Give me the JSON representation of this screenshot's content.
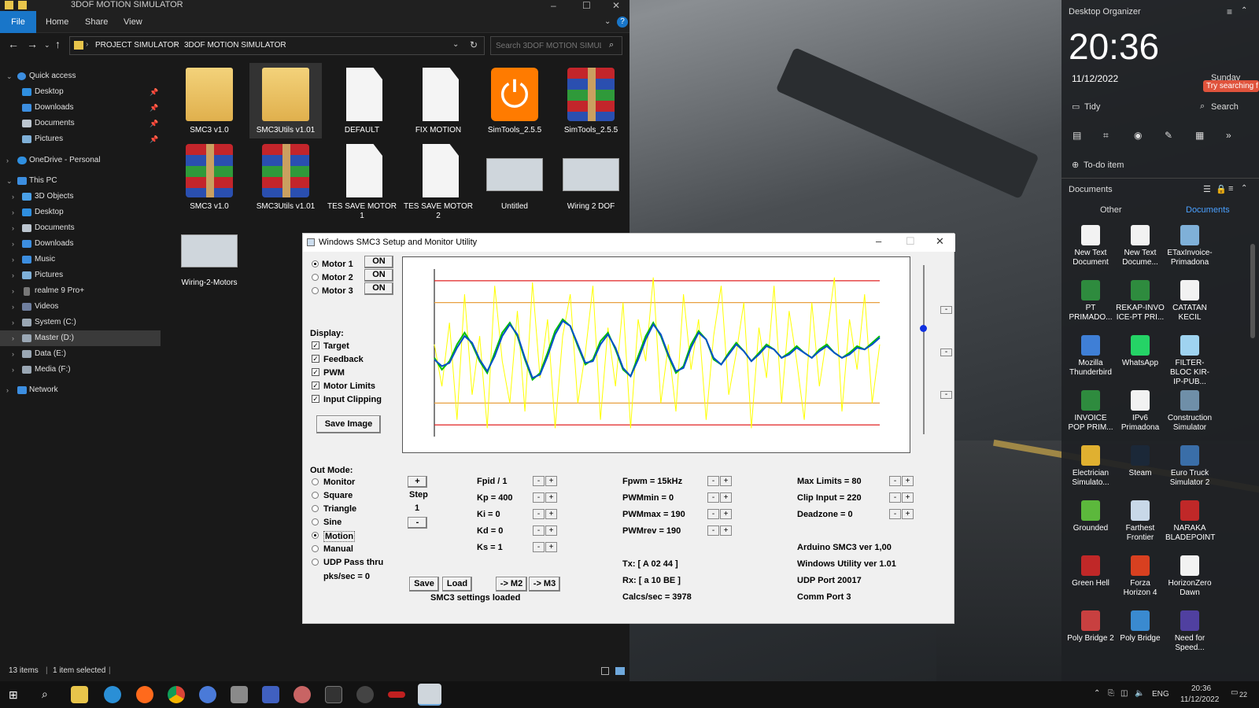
{
  "explorer": {
    "window_title": "3DOF MOTION SIMULATOR",
    "ribbon_tabs": [
      "File",
      "Home",
      "Share",
      "View"
    ],
    "breadcrumb": [
      "PROJECT SIMULATOR",
      "3DOF MOTION SIMULATOR"
    ],
    "search_placeholder": "Search 3DOF MOTION SIMUL...",
    "nav": {
      "quick_access": "Quick access",
      "quick_items": [
        "Desktop",
        "Downloads",
        "Documents",
        "Pictures"
      ],
      "onedrive": "OneDrive - Personal",
      "this_pc": "This PC",
      "pc_items": [
        "3D Objects",
        "Desktop",
        "Documents",
        "Downloads",
        "Music",
        "Pictures",
        "realme 9 Pro+",
        "Videos",
        "System (C:)",
        "Master (D:)",
        "Data (E:)",
        "Media (F:)"
      ],
      "network": "Network"
    },
    "files": [
      {
        "name": "SMC3 v1.0",
        "kind": "folder"
      },
      {
        "name": "SMC3Utils v1.01",
        "kind": "folder"
      },
      {
        "name": "DEFAULT",
        "kind": "doc"
      },
      {
        "name": "FIX MOTION",
        "kind": "doc"
      },
      {
        "name": "SimTools_2.5.5",
        "kind": "simtools"
      },
      {
        "name": "SimTools_2.5.5",
        "kind": "rar"
      },
      {
        "name": "SMC3 v1.0",
        "kind": "rar"
      },
      {
        "name": "SMC3Utils v1.01",
        "kind": "rar"
      },
      {
        "name": "TES SAVE MOTOR 1",
        "kind": "doc"
      },
      {
        "name": "TES SAVE MOTOR 2",
        "kind": "doc"
      },
      {
        "name": "Untitled",
        "kind": "thumb"
      },
      {
        "name": "Wiring 2 DOF",
        "kind": "thumb"
      },
      {
        "name": "Wiring-2-Motors",
        "kind": "thumb"
      }
    ],
    "status": {
      "items": "13 items",
      "selected": "1 item selected"
    }
  },
  "smc3": {
    "title": "Windows SMC3 Setup and Monitor Utility",
    "motors": [
      {
        "label": "Motor 1",
        "state": "ON",
        "selected": true
      },
      {
        "label": "Motor 2",
        "state": "ON",
        "selected": false
      },
      {
        "label": "Motor 3",
        "state": "ON",
        "selected": false
      }
    ],
    "display_label": "Display:",
    "display_items": [
      "Target",
      "Feedback",
      "PWM",
      "Motor Limits",
      "Input Clipping"
    ],
    "save_image": "Save Image",
    "out_mode_label": "Out Mode:",
    "out_modes": [
      "Monitor",
      "Square",
      "Triangle",
      "Sine",
      "Motion",
      "Manual",
      "UDP Pass thru"
    ],
    "out_mode_selected": "Motion",
    "pks": "pks/sec = 0",
    "step": {
      "plus": "+",
      "label": "Step",
      "value": "1",
      "minus": "-"
    },
    "params_col1": [
      "Fpid / 1",
      "Kp = 400",
      "Ki = 0",
      "Kd = 0",
      "Ks = 1"
    ],
    "params_col2": [
      "Fpwm = 15kHz",
      "PWMmin = 0",
      "PWMmax = 190",
      "PWMrev = 190"
    ],
    "params_col3": [
      "Max Limits = 80",
      "Clip Input = 220",
      "Deadzone = 0"
    ],
    "buttons": {
      "save": "Save",
      "load": "Load",
      "m2": "-> M2",
      "m3": "-> M3"
    },
    "settings_msg": "SMC3 settings loaded",
    "tx": "Tx: [ A 02 44 ]",
    "rx": "Rx: [ a 10 BE ]",
    "calcs": "Calcs/sec = 3978",
    "info": [
      "Arduino SMC3 ver 1,00",
      "Windows Utility ver 1.01",
      "UDP Port 20017",
      "Comm Port 3"
    ],
    "pm_minus": "-",
    "pm_plus": "+",
    "side_btn": "-"
  },
  "organizer": {
    "title": "Desktop Organizer",
    "time": "20:36",
    "date": "11/12/2022",
    "day": "Sunday",
    "tooltip": "Try searching f",
    "tidy": "Tidy",
    "search": "Search",
    "todo": "To-do item",
    "docs_title": "Documents",
    "tabs": [
      "Other",
      "Documents"
    ],
    "icons": [
      {
        "label": "New Text Document",
        "color": "#f2f2f2"
      },
      {
        "label": "New Text Docume...",
        "color": "#f2f2f2"
      },
      {
        "label": "ETaxInvoice-Primadona",
        "color": "#7fb0d8"
      },
      {
        "label": "PT PRIMADO...",
        "color": "#2e8b3e"
      },
      {
        "label": "REKAP-INVO ICE-PT PRI...",
        "color": "#2e8b3e"
      },
      {
        "label": "CATATAN KECIL",
        "color": "#f2f2f2"
      },
      {
        "label": "Mozilla Thunderbird",
        "color": "#3f7fd6"
      },
      {
        "label": "WhatsApp",
        "color": "#25d366"
      },
      {
        "label": "FILTER-BLOC KIR-IP-PUB...",
        "color": "#9fd3f0"
      },
      {
        "label": "INVOICE POP PRIM...",
        "color": "#2e8b3e"
      },
      {
        "label": "IPv6 Primadona",
        "color": "#f2f2f2"
      },
      {
        "label": "Construction Simulator",
        "color": "#6f8fa8"
      },
      {
        "label": "Electrician Simulato...",
        "color": "#e0b030"
      },
      {
        "label": "Steam",
        "color": "#1b2838"
      },
      {
        "label": "Euro Truck Simulator 2",
        "color": "#3a6ea8"
      },
      {
        "label": "Grounded",
        "color": "#5cb83c"
      },
      {
        "label": "Farthest Frontier",
        "color": "#c8d8e8"
      },
      {
        "label": "NARAKA BLADEPOINT",
        "color": "#c02828"
      },
      {
        "label": "Green Hell",
        "color": "#c02828"
      },
      {
        "label": "Forza Horizon 4",
        "color": "#d84020"
      },
      {
        "label": "HorizonZero Dawn",
        "color": "#f2f2f2"
      },
      {
        "label": "Poly Bridge 2",
        "color": "#c84040"
      },
      {
        "label": "Poly Bridge",
        "color": "#3a8ad0"
      },
      {
        "label": "Need for Speed...",
        "color": "#5040a0"
      }
    ]
  },
  "taskbar": {
    "lang": "ENG",
    "time": "20:36",
    "date": "11/12/2022",
    "notif": "22"
  },
  "chart_data": {
    "type": "line",
    "title": "",
    "xlabel": "",
    "ylabel": "",
    "limit_lines": {
      "red": [
        0.93,
        0.07
      ],
      "orange": [
        0.8,
        0.2
      ]
    },
    "series": [
      {
        "color": "#ffff00",
        "values": [
          0.55,
          0.3,
          0.68,
          0.1,
          0.85,
          0.25,
          0.6,
          0.05,
          0.9,
          0.45,
          0.2,
          0.75,
          0.15,
          0.92,
          0.35,
          0.7,
          0.05,
          0.6,
          0.85,
          0.2,
          0.5,
          0.9,
          0.1,
          0.65,
          0.3,
          0.8,
          0.05,
          0.7,
          0.45,
          0.95,
          0.2,
          0.55,
          0.15,
          0.85,
          0.4,
          0.7,
          0.1,
          0.6,
          0.9,
          0.25,
          0.5,
          0.8,
          0.05,
          0.65,
          0.35,
          0.9,
          0.2,
          0.75,
          0.45,
          0.1,
          0.8,
          0.3,
          0.6,
          0.95,
          0.15,
          0.7,
          0.4,
          0.85,
          0.2,
          0.55
        ]
      },
      {
        "color": "#00c000",
        "values": [
          0.47,
          0.4,
          0.45,
          0.55,
          0.62,
          0.55,
          0.45,
          0.38,
          0.5,
          0.62,
          0.68,
          0.6,
          0.46,
          0.34,
          0.38,
          0.5,
          0.63,
          0.7,
          0.66,
          0.54,
          0.43,
          0.46,
          0.57,
          0.62,
          0.52,
          0.4,
          0.36,
          0.48,
          0.6,
          0.68,
          0.6,
          0.48,
          0.38,
          0.42,
          0.55,
          0.63,
          0.58,
          0.46,
          0.43,
          0.5,
          0.56,
          0.51,
          0.45,
          0.5,
          0.55,
          0.52,
          0.47,
          0.5,
          0.54,
          0.5,
          0.47,
          0.52,
          0.55,
          0.5,
          0.47,
          0.5,
          0.54,
          0.52,
          0.56,
          0.6
        ]
      },
      {
        "color": "#0050c8",
        "values": [
          0.46,
          0.42,
          0.44,
          0.53,
          0.6,
          0.56,
          0.46,
          0.39,
          0.48,
          0.6,
          0.67,
          0.61,
          0.47,
          0.35,
          0.37,
          0.48,
          0.61,
          0.69,
          0.66,
          0.55,
          0.44,
          0.45,
          0.55,
          0.61,
          0.53,
          0.41,
          0.36,
          0.46,
          0.58,
          0.67,
          0.61,
          0.49,
          0.39,
          0.41,
          0.53,
          0.62,
          0.58,
          0.47,
          0.43,
          0.49,
          0.55,
          0.51,
          0.45,
          0.49,
          0.54,
          0.52,
          0.47,
          0.49,
          0.53,
          0.5,
          0.47,
          0.51,
          0.54,
          0.5,
          0.47,
          0.49,
          0.53,
          0.52,
          0.55,
          0.59
        ]
      }
    ]
  }
}
